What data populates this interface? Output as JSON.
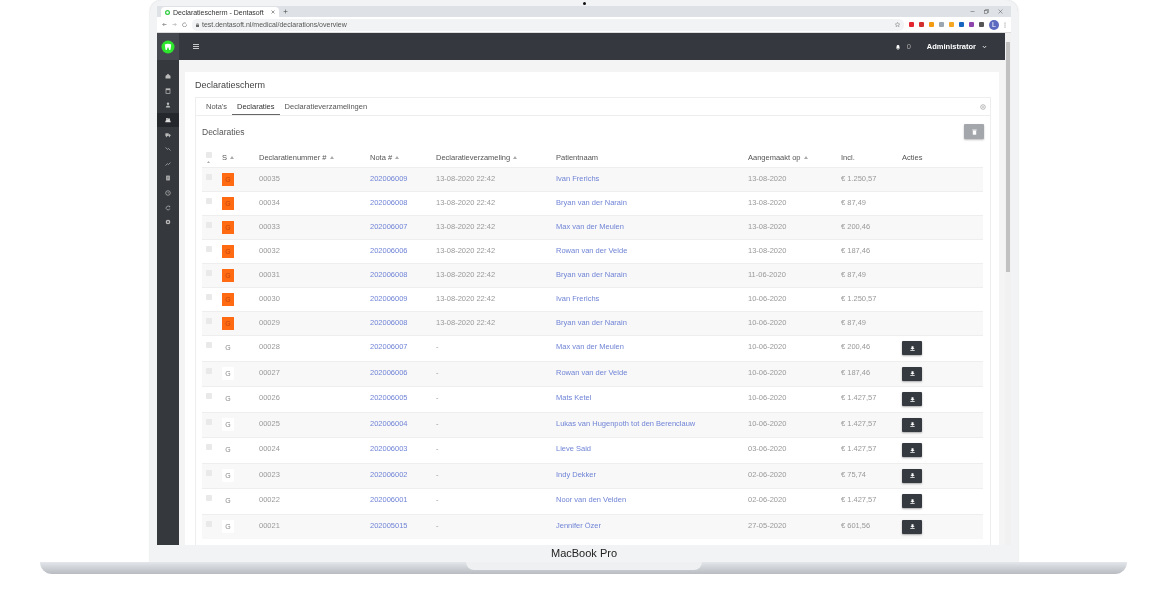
{
  "device": {
    "label": "MacBook Pro"
  },
  "browser": {
    "tab_title": "Declaratiescherm - Dentasoft",
    "url": "test.dentasoft.nl/medical/declarations/overview",
    "profile_initial": "L"
  },
  "navbar": {
    "notification_count": "0",
    "user": "Administrator"
  },
  "sidebar": {
    "items": [
      {
        "selected": false
      },
      {
        "selected": false
      },
      {
        "selected": false
      },
      {
        "selected": true
      },
      {
        "selected": false
      },
      {
        "selected": false
      },
      {
        "selected": false
      },
      {
        "selected": false
      },
      {
        "selected": false
      },
      {
        "selected": false
      },
      {
        "selected": false
      }
    ]
  },
  "page_title": "Declaratiescherm",
  "tabs": [
    {
      "label": "Nota's",
      "selected": false
    },
    {
      "label": "Declaraties",
      "selected": true
    },
    {
      "label": "Declaratieverzamelingen",
      "selected": false
    }
  ],
  "section_title": "Declaraties",
  "table": {
    "select_all_checked": false,
    "columns": [
      {
        "label": "S",
        "sortable": true
      },
      {
        "label": "Declaratienummer #",
        "sortable": true
      },
      {
        "label": "Nota #",
        "sortable": true
      },
      {
        "label": "Declaratieverzameling",
        "sortable": true
      },
      {
        "label": "Patientnaam",
        "sortable": false
      },
      {
        "label": "Aangemaakt op",
        "sortable": true
      },
      {
        "label": "Incl.",
        "sortable": false
      },
      {
        "label": "Acties",
        "sortable": false
      }
    ],
    "rows": [
      {
        "checked": false,
        "status": {
          "kind": "pending",
          "label": "G"
        },
        "number": "00035",
        "nota": "202006009",
        "collection": "13-08-2020 22:42",
        "patient": "Ivan Frerichs",
        "created": "13-08-2020",
        "incl": "€ 1.250,57",
        "download": false
      },
      {
        "checked": false,
        "status": {
          "kind": "pending",
          "label": "G"
        },
        "number": "00034",
        "nota": "202006008",
        "collection": "13-08-2020 22:42",
        "patient": "Bryan van der Narain",
        "created": "13-08-2020",
        "incl": "€ 87,49",
        "download": false
      },
      {
        "checked": false,
        "status": {
          "kind": "pending",
          "label": "G"
        },
        "number": "00033",
        "nota": "202006007",
        "collection": "13-08-2020 22:42",
        "patient": "Max van der Meulen",
        "created": "13-08-2020",
        "incl": "€ 200,46",
        "download": false
      },
      {
        "checked": false,
        "status": {
          "kind": "pending",
          "label": "G"
        },
        "number": "00032",
        "nota": "202006006",
        "collection": "13-08-2020 22:42",
        "patient": "Rowan van der Velde",
        "created": "13-08-2020",
        "incl": "€ 187,46",
        "download": false
      },
      {
        "checked": false,
        "status": {
          "kind": "pending",
          "label": "G"
        },
        "number": "00031",
        "nota": "202006008",
        "collection": "13-08-2020 22:42",
        "patient": "Bryan van der Narain",
        "created": "11-06-2020",
        "incl": "€ 87,49",
        "download": false
      },
      {
        "checked": false,
        "status": {
          "kind": "pending",
          "label": "G"
        },
        "number": "00030",
        "nota": "202006009",
        "collection": "13-08-2020 22:42",
        "patient": "Ivan Frerichs",
        "created": "10-06-2020",
        "incl": "€ 1.250,57",
        "download": false
      },
      {
        "checked": false,
        "status": {
          "kind": "pending",
          "label": "G"
        },
        "number": "00029",
        "nota": "202006008",
        "collection": "13-08-2020 22:42",
        "patient": "Bryan van der Narain",
        "created": "10-06-2020",
        "incl": "€ 87,49",
        "download": false
      },
      {
        "checked": false,
        "status": {
          "kind": "generated",
          "label": "G"
        },
        "number": "00028",
        "nota": "202006007",
        "collection": "-",
        "patient": "Max van der Meulen",
        "created": "10-06-2020",
        "incl": "€ 200,46",
        "download": true
      },
      {
        "checked": false,
        "status": {
          "kind": "generated",
          "label": "G"
        },
        "number": "00027",
        "nota": "202006006",
        "collection": "-",
        "patient": "Rowan van der Velde",
        "created": "10-06-2020",
        "incl": "€ 187,46",
        "download": true
      },
      {
        "checked": false,
        "status": {
          "kind": "generated",
          "label": "G"
        },
        "number": "00026",
        "nota": "202006005",
        "collection": "-",
        "patient": "Mats Ketel",
        "created": "10-06-2020",
        "incl": "€ 1.427,57",
        "download": true
      },
      {
        "checked": false,
        "status": {
          "kind": "generated",
          "label": "G"
        },
        "number": "00025",
        "nota": "202006004",
        "collection": "-",
        "patient": "Lukas van Hugenpoth tot den Berenclauw",
        "created": "10-06-2020",
        "incl": "€ 1.427,57",
        "download": true
      },
      {
        "checked": false,
        "status": {
          "kind": "generated",
          "label": "G"
        },
        "number": "00024",
        "nota": "202006003",
        "collection": "-",
        "patient": "Lieve Said",
        "created": "03-06-2020",
        "incl": "€ 1.427,57",
        "download": true
      },
      {
        "checked": false,
        "status": {
          "kind": "generated",
          "label": "G"
        },
        "number": "00023",
        "nota": "202006002",
        "collection": "-",
        "patient": "Indy Dekker",
        "created": "02-06-2020",
        "incl": "€ 75,74",
        "download": true
      },
      {
        "checked": false,
        "status": {
          "kind": "generated",
          "label": "G"
        },
        "number": "00022",
        "nota": "202006001",
        "collection": "-",
        "patient": "Noor van den Velden",
        "created": "02-06-2020",
        "incl": "€ 1.427,57",
        "download": true
      },
      {
        "checked": false,
        "status": {
          "kind": "generated",
          "label": "G"
        },
        "number": "00021",
        "nota": "202005015",
        "collection": "-",
        "patient": "Jennifer Özer",
        "created": "27-05-2020",
        "incl": "€ 601,56",
        "download": true
      }
    ]
  }
}
